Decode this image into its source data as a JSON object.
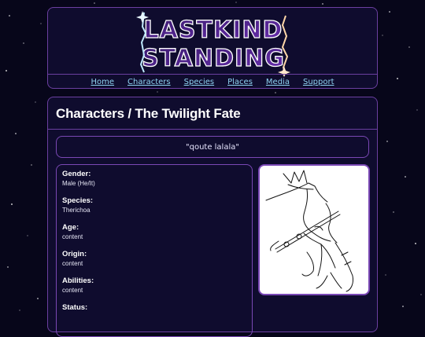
{
  "site": {
    "logo_text": "LAST KIND STANDING"
  },
  "nav": {
    "items": [
      {
        "label": "Home"
      },
      {
        "label": "Characters"
      },
      {
        "label": "Species"
      },
      {
        "label": "Places"
      },
      {
        "label": "Media"
      },
      {
        "label": "Support"
      }
    ]
  },
  "page": {
    "title": "Characters / The Twilight Fate",
    "quote": "\"qoute lalala\""
  },
  "info": {
    "fields": [
      {
        "label": "Gender:",
        "value": "Male (He/It)"
      },
      {
        "label": "Species:",
        "value": "Therichoa"
      },
      {
        "label": "Age:",
        "value": "content"
      },
      {
        "label": "Origin:",
        "value": "content"
      },
      {
        "label": "Abilities:",
        "value": "content"
      },
      {
        "label": "Status:",
        "value": ""
      }
    ]
  },
  "colors": {
    "background": "#07061a",
    "panel": "#0f0c2e",
    "border": "#6b3fa0",
    "link": "#8fd4f2",
    "logo_purple": "#7b3fc4"
  }
}
